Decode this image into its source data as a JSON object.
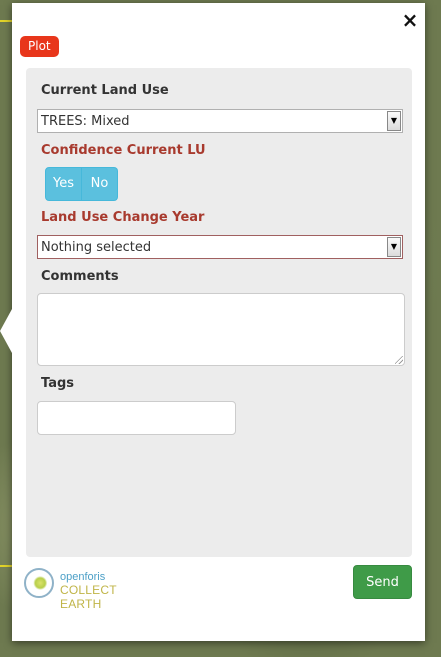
{
  "popup": {
    "close_symbol": "×",
    "tab_label": "Plot"
  },
  "form": {
    "current_land_use": {
      "label": "Current Land Use",
      "value": "TREES: Mixed"
    },
    "confidence": {
      "label": "Confidence Current LU",
      "yes_label": "Yes",
      "no_label": "No"
    },
    "change_year": {
      "label": "Land Use Change Year",
      "value": "Nothing selected"
    },
    "comments": {
      "label": "Comments",
      "value": ""
    },
    "tags": {
      "label": "Tags",
      "value": ""
    }
  },
  "footer": {
    "logo_top": "openforis",
    "logo_bottom": "COLLECT EARTH",
    "send_label": "Send"
  },
  "colors": {
    "plot_tab": "#e8361b",
    "toggle_button": "#5bc0de",
    "send_button": "#3f9b48",
    "required_label": "#a83a2e"
  },
  "icons": {
    "close": "close-icon",
    "dropdown": "chevron-down-icon",
    "logo": "openforis-logo-icon"
  }
}
